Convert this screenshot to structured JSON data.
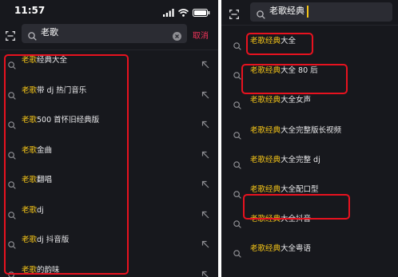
{
  "colors": {
    "background": "#17181d",
    "search_box": "#2b2c33",
    "highlight": "#f5c518",
    "cancel": "#f2345a",
    "annotation": "#e8121f"
  },
  "left": {
    "status": {
      "time": "11:57",
      "icons": [
        "signal-icon",
        "wifi-icon",
        "battery-icon"
      ]
    },
    "search": {
      "query": "老歌",
      "cancel_label": "取消"
    },
    "suggestions": [
      {
        "hl": "老歌",
        "rest": "经典大全"
      },
      {
        "hl": "老歌",
        "rest": "带 dj 热门音乐"
      },
      {
        "hl": "老歌",
        "rest": "500 首怀旧经典版"
      },
      {
        "hl": "老歌",
        "rest": "金曲"
      },
      {
        "hl": "老歌",
        "rest": "翻唱"
      },
      {
        "hl": "老歌",
        "rest": "dj"
      },
      {
        "hl": "老歌",
        "rest": "dj 抖音版"
      },
      {
        "hl": "老歌",
        "rest": "的韵味"
      }
    ]
  },
  "right": {
    "search": {
      "query": "老歌经典"
    },
    "suggestions": [
      {
        "hl": "老歌经典",
        "rest": "大全"
      },
      {
        "hl": "老歌经典",
        "rest": "大全 80 后"
      },
      {
        "hl": "老歌经典",
        "rest": "大全女声"
      },
      {
        "hl": "老歌经典",
        "rest": "大全完整版长视频"
      },
      {
        "hl": "老歌经典",
        "rest": "大全完整 dj"
      },
      {
        "hl": "老歌经典",
        "rest": "大全配口型"
      },
      {
        "hl": "老歌经典",
        "rest": "大全抖音"
      },
      {
        "hl": "老歌经典",
        "rest": "大全粤语"
      }
    ]
  }
}
